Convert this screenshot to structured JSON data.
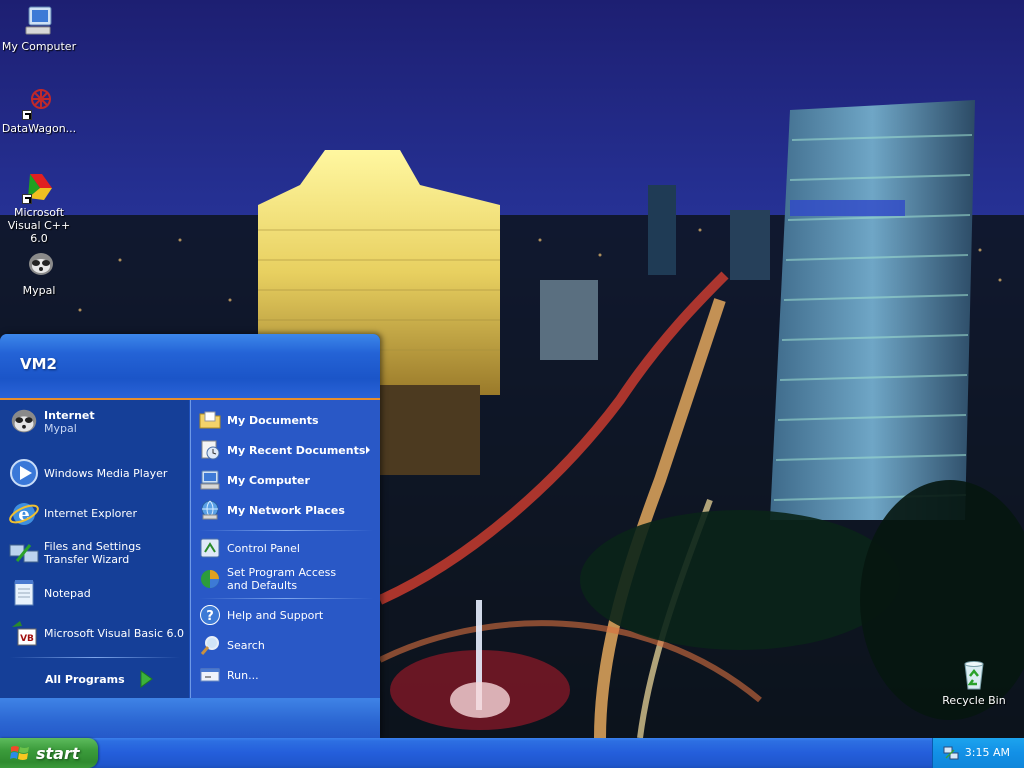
{
  "desktop": {
    "icons": [
      {
        "label": "My Computer",
        "icon": "my-computer-icon"
      },
      {
        "label": "DataWagon...",
        "icon": "datawagon-icon"
      },
      {
        "label": "Microsoft Visual C++ 6.0",
        "icon": "visual-cpp-icon"
      },
      {
        "label": "Mypal",
        "icon": "mypal-icon"
      },
      {
        "label": "Recycle Bin",
        "icon": "recycle-bin-icon"
      }
    ]
  },
  "start_menu": {
    "user_name": "VM2",
    "left": {
      "pinned": {
        "title": "Internet",
        "subtitle": "Mypal",
        "icon": "mypal-icon"
      },
      "items": [
        {
          "label": "Windows Media Player",
          "icon": "media-player-icon"
        },
        {
          "label": "Internet Explorer",
          "icon": "internet-explorer-icon"
        },
        {
          "label": "Files and Settings Transfer Wizard",
          "icon": "transfer-wizard-icon"
        },
        {
          "label": "Notepad",
          "icon": "notepad-icon"
        },
        {
          "label": "Microsoft Visual Basic 6.0",
          "icon": "visual-basic-icon"
        }
      ],
      "all_programs": "All Programs"
    },
    "right": {
      "items": [
        {
          "label": "My Documents",
          "icon": "documents-folder-icon"
        },
        {
          "label": "My Recent Documents",
          "icon": "recent-documents-icon"
        },
        {
          "label": "My Computer",
          "icon": "my-computer-icon"
        },
        {
          "label": "My Network Places",
          "icon": "network-places-icon"
        },
        {
          "label": "Control Panel",
          "icon": "control-panel-icon"
        },
        {
          "label": "Set Program Access and Defaults",
          "icon": "program-access-icon"
        },
        {
          "label": "Help and Support",
          "icon": "help-icon"
        },
        {
          "label": "Search",
          "icon": "search-icon"
        },
        {
          "label": "Run...",
          "icon": "run-icon"
        }
      ]
    }
  },
  "taskbar": {
    "start_label": "start",
    "clock": "3:15 AM"
  },
  "colors": {
    "start_menu_left": "#153f98",
    "start_menu_right": "#2958c6",
    "start_button": "#3c9c3c",
    "taskbar": "#245edb",
    "tray": "#1290e6"
  }
}
